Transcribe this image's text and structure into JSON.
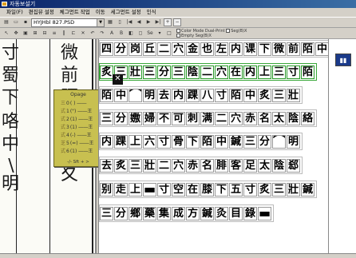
{
  "window": {
    "title": "자동보설기"
  },
  "menu": [
    "파일(F)",
    "편집뷰 설정",
    "체그먼트 작업",
    "이동",
    "세그먼트 설정",
    "인식"
  ],
  "toolbar": {
    "file_name": "HYJHbl 827.PSD",
    "zoom_label": "Se",
    "option_small_a": "Color Mode Dual-Print",
    "option_small_b": "Empty Seg(B)X",
    "option_small_c": "Seg(B)X"
  },
  "popup": {
    "title": "Opage",
    "rows": [
      {
        "ch": "三",
        "n": "0",
        "v": "(  ) ――"
      },
      {
        "ch": "式",
        "n": "1",
        "v": "(\") ――王"
      },
      {
        "ch": "式",
        "n": "2",
        "v": "(1) ――王"
      },
      {
        "ch": "式",
        "n": "3",
        "v": "(1) ――王"
      },
      {
        "ch": "式",
        "n": "4",
        "v": "(-) ――王"
      },
      {
        "ch": "芝",
        "n": "5",
        "v": "(=) ――王"
      },
      {
        "ch": "式",
        "n": "6",
        "v": "(1) ――王"
      }
    ],
    "footer": "-/- Sft + >"
  },
  "scan_chars": [
    "寸",
    "蜀",
    "下",
    "咯",
    "中",
    "∖",
    "明",
    "微",
    "前",
    "陌",
    "中",
    "夊"
  ],
  "text_lines": [
    {
      "chars": [
        "四",
        "分",
        "岗",
        "丘",
        "二",
        "穴",
        "金",
        "也",
        "左",
        "内",
        "课",
        "下",
        "微",
        "前",
        "陌",
        "中"
      ]
    },
    {
      "chars": [
        "炙",
        "三",
        "壯",
        "三",
        "分",
        "三",
        "陰",
        "二",
        "穴",
        "在",
        "内",
        "上",
        "三",
        "寸",
        "陌"
      ],
      "selected": true
    },
    {
      "chars": [
        "陌",
        "中",
        "⌒",
        "明",
        "去",
        "内",
        "踝",
        "八",
        "寸",
        "陌",
        "中",
        "炙",
        "三",
        "壯"
      ]
    },
    {
      "chars": [
        "三",
        "分",
        "嫐",
        "婦",
        "不",
        "可",
        "刺",
        "满",
        "二",
        "穴",
        "赤",
        "名",
        "太",
        "陰",
        "絡"
      ]
    },
    {
      "chars": [
        "内",
        "踝",
        "上",
        "六",
        "寸",
        "骨",
        "下",
        "陌",
        "中",
        "鍼",
        "三",
        "分",
        "⌒",
        "明"
      ]
    },
    {
      "chars": [
        "去",
        "炙",
        "三",
        "壯",
        "二",
        "穴",
        "赤",
        "名",
        "腓",
        "客",
        "足",
        "太",
        "陰",
        "郄"
      ]
    },
    {
      "chars": [
        "别",
        "走",
        "上",
        "▬",
        "寸",
        "空",
        "在",
        "膝",
        "下",
        "五",
        "寸",
        "炙",
        "三",
        "壯",
        "鍼"
      ]
    },
    {
      "chars": [
        "三",
        "分",
        "鄉",
        "藥",
        "集",
        "成",
        "方",
        "鍼",
        "灸",
        "目",
        "錄",
        "▬"
      ]
    }
  ],
  "mark": {
    "label": "✕"
  },
  "colors": {
    "popup_bg": "#c8c050",
    "selection": "#3aa83a",
    "thumb": "#1a3a8a"
  }
}
